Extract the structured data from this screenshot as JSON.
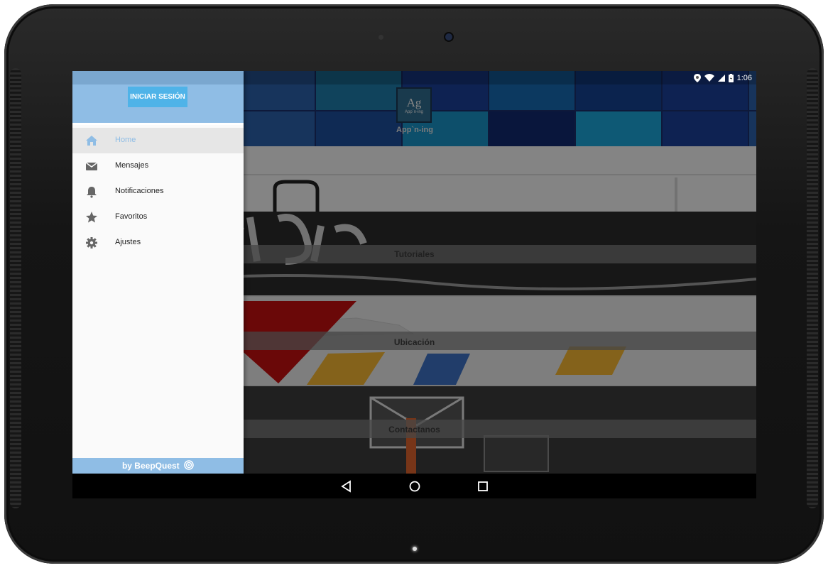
{
  "status_bar": {
    "time": "1:06"
  },
  "header": {
    "app_name": "App`n-ing",
    "logo_symbol": "Ag",
    "logo_small_text": "App`n-ing"
  },
  "cards": [
    {
      "label": "Tutoriales"
    },
    {
      "label": "Ubicación"
    },
    {
      "label": "Contactanos"
    }
  ],
  "drawer": {
    "login_label": "INICIAR SESIÓN",
    "items": [
      {
        "label": "Home",
        "icon": "home-icon"
      },
      {
        "label": "Mensajes",
        "icon": "mail-icon"
      },
      {
        "label": "Notificaciones",
        "icon": "bell-icon"
      },
      {
        "label": "Favoritos",
        "icon": "star-icon"
      },
      {
        "label": "Ajustes",
        "icon": "gear-icon"
      }
    ],
    "footer_text": "by BeepQuest"
  },
  "colors": {
    "drawer_accent": "#8fbde5",
    "login_button": "#4fb3e8",
    "icon_gray": "#666666"
  }
}
